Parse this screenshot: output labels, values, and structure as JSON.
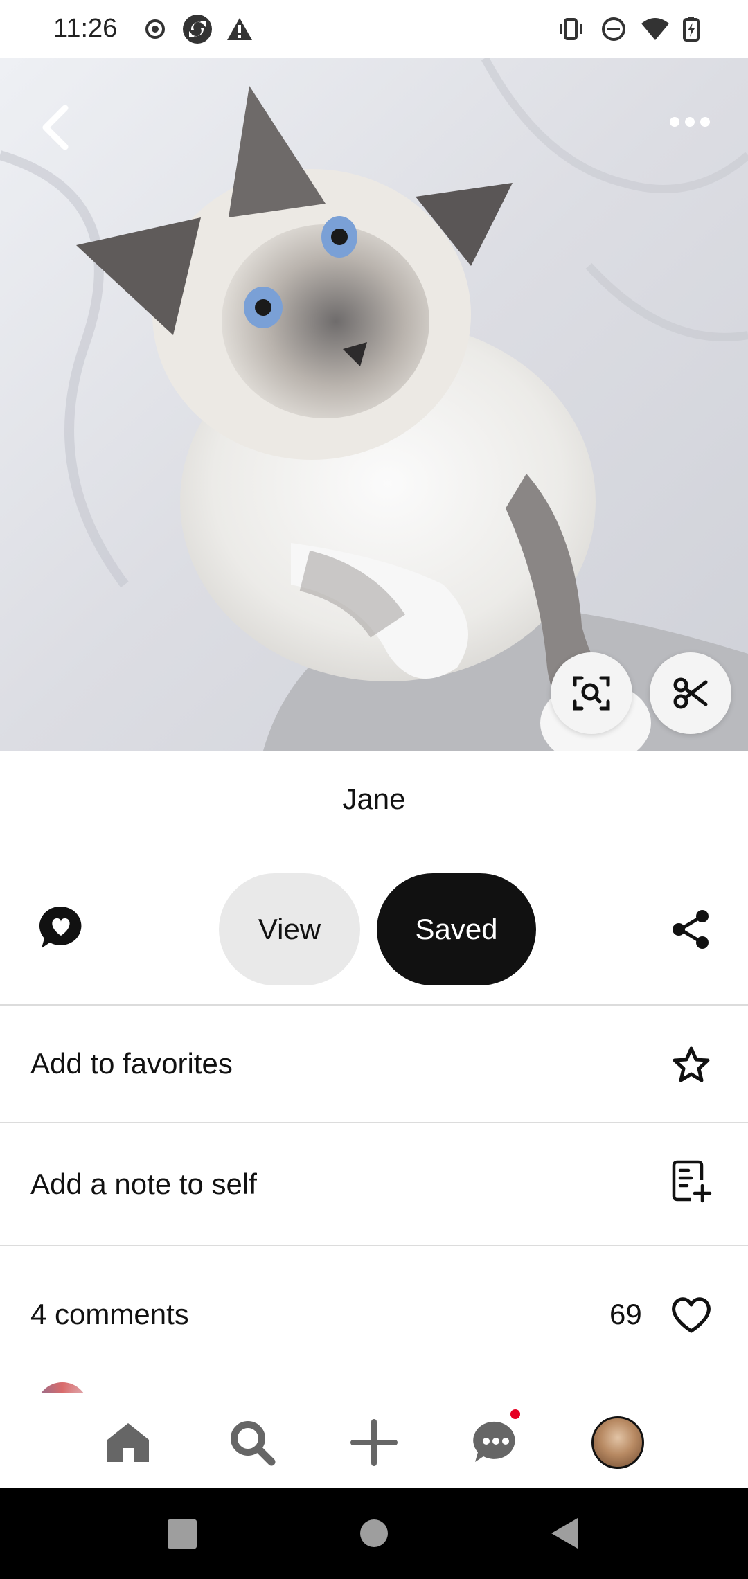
{
  "status_bar": {
    "time": "11:26",
    "left_icons": [
      "record-icon",
      "sync-icon",
      "warning-icon"
    ],
    "right_icons": [
      "vibrate-icon",
      "do-not-disturb-icon",
      "wifi-icon",
      "battery-charging-icon"
    ]
  },
  "hero": {
    "image_icon": "cat-photo",
    "back_icon": "chevron-left-icon",
    "more_icon": "more-horizontal-icon",
    "visual_search_icon": "visual-search-icon",
    "cutout_icon": "scissors-icon"
  },
  "pin": {
    "title": "Jane"
  },
  "actions": {
    "comment_icon": "comment-heart-icon",
    "view_label": "View",
    "saved_label": "Saved",
    "share_icon": "share-icon"
  },
  "rows": {
    "favorites_label": "Add to favorites",
    "favorites_icon": "star-icon",
    "note_label": "Add a note to self",
    "note_icon": "note-add-icon"
  },
  "comments": {
    "count_label": "4 comments",
    "likes": "69",
    "like_icon": "heart-icon"
  },
  "bottom_nav": {
    "items": [
      "home-icon",
      "search-icon",
      "plus-icon",
      "messages-icon",
      "profile-avatar"
    ],
    "notification_color": "#e60023"
  },
  "system_nav": [
    "recents-icon",
    "home-circle-icon",
    "back-triangle-icon"
  ]
}
